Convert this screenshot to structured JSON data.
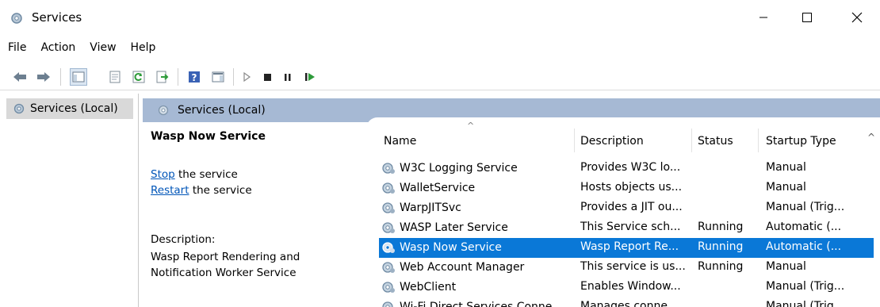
{
  "window": {
    "title": "Services",
    "controls": {
      "minimize": "minimize-icon",
      "maximize": "maximize-icon",
      "close": "close-icon"
    }
  },
  "menu": [
    "File",
    "Action",
    "View",
    "Help"
  ],
  "toolbar": {
    "icons": [
      "back-arrow-icon",
      "forward-arrow-icon",
      "show-hide-console-tree-icon",
      "properties-icon",
      "refresh-icon",
      "export-list-icon",
      "help-icon",
      "show-action-pane-icon",
      "start-service-icon",
      "stop-service-icon",
      "pause-service-icon",
      "restart-service-icon"
    ]
  },
  "tree": {
    "item": "Services (Local)"
  },
  "header": {
    "title": "Services (Local)"
  },
  "details": {
    "title": "Wasp Now Service",
    "stop_link": "Stop",
    "stop_rest": " the service",
    "restart_link": "Restart",
    "restart_rest": " the service",
    "description_label": "Description:",
    "description_line1": "Wasp Report Rendering and",
    "description_line2": "Notification Worker Service"
  },
  "columns": {
    "name": "Name",
    "description": "Description",
    "status": "Status",
    "startup": "Startup Type"
  },
  "rows": [
    {
      "name": "W3C Logging Service",
      "description": "Provides W3C lo...",
      "status": "",
      "startup": "Manual"
    },
    {
      "name": "WalletService",
      "description": "Hosts objects us...",
      "status": "",
      "startup": "Manual"
    },
    {
      "name": "WarpJITSvc",
      "description": "Provides a JIT ou...",
      "status": "",
      "startup": "Manual (Trig..."
    },
    {
      "name": "WASP Later Service",
      "description": "This Service sch...",
      "status": "Running",
      "startup": "Automatic (..."
    },
    {
      "name": "Wasp Now Service",
      "description": "Wasp Report Re...",
      "status": "Running",
      "startup": "Automatic (...",
      "selected": true
    },
    {
      "name": "Web Account Manager",
      "description": "This service is us...",
      "status": "Running",
      "startup": "Manual"
    },
    {
      "name": "WebClient",
      "description": "Enables Window...",
      "status": "",
      "startup": "Manual (Trig..."
    },
    {
      "name": "Wi-Fi Direct Services Conne...",
      "description": "Manages conne...",
      "status": "",
      "startup": "Manual (Trig..."
    }
  ],
  "colors": {
    "selection": "#0a78d7",
    "header_band": "#a6b9d4",
    "link": "#0055b8"
  }
}
